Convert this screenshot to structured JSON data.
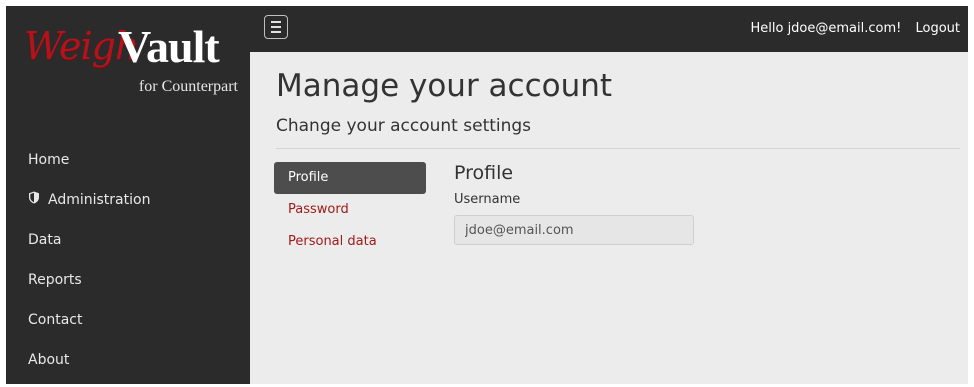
{
  "brand": {
    "name_part1": "Weigh",
    "name_part2": "Vault",
    "tagline": "for Counterpart"
  },
  "topbar": {
    "menu_icon": "hamburger-icon",
    "greeting": "Hello jdoe@email.com!",
    "logout_label": "Logout"
  },
  "sidebar": {
    "items": [
      {
        "label": "Home"
      },
      {
        "label": "Administration",
        "icon": "shield-icon"
      },
      {
        "label": "Data"
      },
      {
        "label": "Reports"
      },
      {
        "label": "Contact"
      },
      {
        "label": "About"
      }
    ]
  },
  "page": {
    "title": "Manage your account",
    "subtitle": "Change your account settings"
  },
  "subnav": {
    "items": [
      {
        "label": "Profile",
        "active": true
      },
      {
        "label": "Password"
      },
      {
        "label": "Personal data"
      }
    ]
  },
  "profile": {
    "heading": "Profile",
    "username_label": "Username",
    "username_value": "jdoe@email.com"
  },
  "colors": {
    "sidebar_bg": "#2b2b2b",
    "content_bg": "#ececec",
    "brand_red": "#b5121b",
    "link_red": "#a11a1a",
    "active_tab_bg": "#4d4d4d"
  }
}
